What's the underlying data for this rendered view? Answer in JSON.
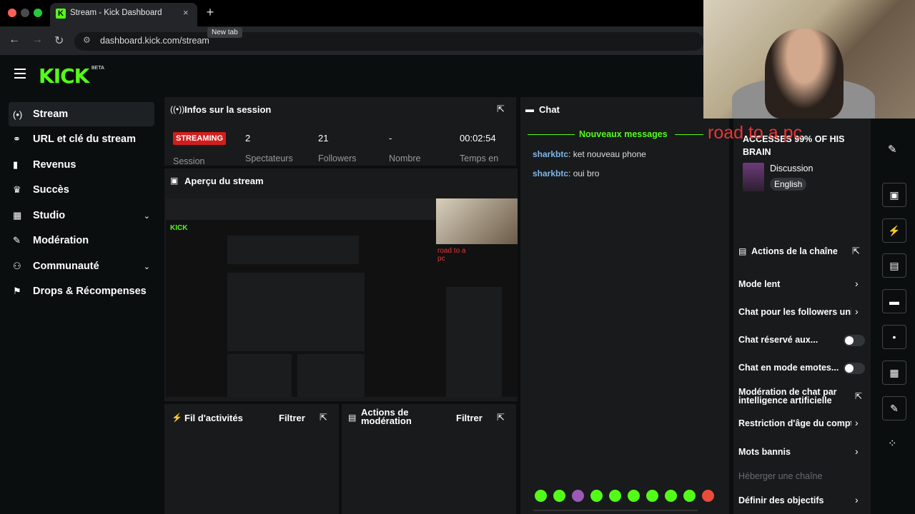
{
  "browser": {
    "tab_title": "Stream - Kick Dashboard",
    "tab_close": "×",
    "new_tab_symbol": "+",
    "tooltip": "New tab",
    "url": "dashboard.kick.com/stream",
    "back": "←",
    "forward": "→",
    "reload": "↻"
  },
  "header": {
    "logo": "KICK",
    "beta": "BETA"
  },
  "sidebar": {
    "items": [
      {
        "label": "Stream",
        "icon": "(•)",
        "active": true
      },
      {
        "label": "URL et clé du stream",
        "icon": "⚭"
      },
      {
        "label": "Revenus",
        "icon": "▮"
      },
      {
        "label": "Succès",
        "icon": "♛"
      },
      {
        "label": "Studio",
        "icon": "▦",
        "chevron": "⌄"
      },
      {
        "label": "Modération",
        "icon": "✎"
      },
      {
        "label": "Communauté",
        "icon": "⚇",
        "chevron": "⌄"
      },
      {
        "label": "Drops & Récompenses",
        "icon": "⚑"
      }
    ]
  },
  "session": {
    "title": "Infos sur la session",
    "badge": "STREAMING",
    "stats": [
      {
        "value": "2",
        "label": "Spectateurs"
      },
      {
        "value": "21",
        "label": "Followers"
      },
      {
        "value": "-",
        "label": "Nombre"
      },
      {
        "value": "00:02:54",
        "label": "Temps en"
      }
    ],
    "session_label": "Session"
  },
  "preview": {
    "title": "Aperçu du stream"
  },
  "chat": {
    "title": "Chat",
    "new_messages": "Nouveaux messages",
    "messages": [
      {
        "user": "sharkbtc",
        "text": ": ket nouveau phone"
      },
      {
        "user": "sharkbtc",
        "text": ": oui bro"
      }
    ]
  },
  "stream_info": {
    "overlay": "road to a pc",
    "title": "ACCESSES 99% OF HIS BRAIN",
    "category": "Discussion",
    "language": "English"
  },
  "channel_actions": {
    "title": "Actions de la chaîne",
    "items": [
      {
        "label": "Mode lent",
        "control": "chevron"
      },
      {
        "label": "Chat pour les followers uniquement",
        "control": "chevron"
      },
      {
        "label": "Chat réservé aux...",
        "control": "toggle"
      },
      {
        "label": "Chat en mode emotes...",
        "control": "toggle"
      },
      {
        "label": "Modération de chat par intelligence artificielle",
        "control": "external"
      },
      {
        "label": "Restriction d'âge du compte",
        "control": "chevron"
      },
      {
        "label": "Mots bannis",
        "control": "chevron"
      },
      {
        "label": "Héberger une chaîne",
        "control": "none"
      },
      {
        "label": "Définir des objectifs",
        "control": "chevron"
      }
    ]
  },
  "activity": {
    "title": "Fil d'activités",
    "filter": "Filtrer"
  },
  "mod_actions": {
    "title": "Actions de modération",
    "filter": "Filtrer"
  },
  "colors": {
    "accent": "#53fc18",
    "live": "#d21d1d",
    "panel": "#181a1c",
    "background": "#0b0e0f"
  }
}
